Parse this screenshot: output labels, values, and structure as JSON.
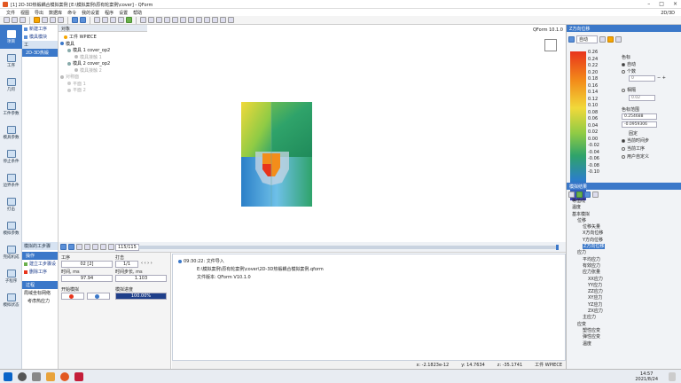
{
  "window": {
    "title": "[1] 2D-3D热锻耦合模拟案例 [E:\\模拟案例\\原有轮案例\\cover] - QForm",
    "view_mode": "2D/3D"
  },
  "menu": {
    "items": [
      "文件",
      "视图",
      "导出",
      "数据库",
      "命令",
      "我的设置",
      "程序",
      "设置",
      "帮助"
    ]
  },
  "left_nav": {
    "items": [
      "项目",
      "工序",
      "几何",
      "工件参数",
      "模具参数",
      "停止条件",
      "边界条件",
      "打击",
      "模拟参数",
      "完成机成",
      "子程序",
      "模拟状态"
    ]
  },
  "process_panel": {
    "new_label": "新建工序",
    "tool_label": "模具模块",
    "section": "工",
    "item": "2D-3D热锻"
  },
  "object_panel": {
    "header": "对象",
    "version": "QForm 10.1.0"
  },
  "tree": [
    {
      "label": "工件 WPIECE",
      "color": "#f7a600"
    },
    {
      "label": "模具",
      "color": "#3b78c9"
    },
    {
      "label": "模具 1 cover_op2",
      "color": "#8aa"
    },
    {
      "label": "模具接触 1",
      "color": "#bbb"
    },
    {
      "label": "模具 2 cover_op2",
      "color": "#8aa"
    },
    {
      "label": "模具接触 2",
      "color": "#bbb"
    },
    {
      "label": "对称面",
      "color": "#bbb"
    },
    {
      "label": "平面 1",
      "color": "#ccc"
    },
    {
      "label": "平面 2",
      "color": "#ccc"
    }
  ],
  "results_panel": {
    "header": "Z方向位移",
    "mode": "自动"
  },
  "color_scale": {
    "ticks": [
      "0.26",
      "0.24",
      "0.22",
      "0.20",
      "0.18",
      "0.16",
      "0.14",
      "0.12",
      "0.10",
      "0.08",
      "0.06",
      "0.04",
      "0.02",
      "0.00",
      "-0.02",
      "-0.04",
      "-0.06",
      "-0.08",
      "-0.10"
    ]
  },
  "scale_options": {
    "color_label": "色标",
    "auto": "自动",
    "count": "个数",
    "count_value": "0",
    "relative": "相隔",
    "relative_value": "0.02",
    "range_label": "色标范围",
    "max": "0.254688",
    "min": "-0.0959306",
    "fixed": "固定",
    "current_step": "当前时间步",
    "current_process": "当前工序",
    "user_defined": "用户自定义"
  },
  "results_tree": {
    "header": "模拟结果",
    "items": [
      "等值线",
      "温度",
      "基本模拟",
      "位移",
      "位移矢量",
      "X方向位移",
      "Y方向位移",
      "Z方向位移",
      "应力",
      "平均应力",
      "有效应力",
      "应力张量",
      "XX应力",
      "YY应力",
      "ZZ应力",
      "XY应力",
      "YZ应力",
      "ZX应力",
      "主应力",
      "应变",
      "塑性应变",
      "弹性应变",
      "温度"
    ],
    "selected": "Z方向位移"
  },
  "sim_panel": {
    "header": "模拟的工步骤",
    "section1": "操作",
    "item1": "建立工步骤设",
    "item2": "删除工序",
    "section2": "过程",
    "item3": "局域坐标网络",
    "item4": "考虑热应力"
  },
  "timebar": {
    "step": "115/115"
  },
  "params": {
    "process_label": "工序",
    "process_value": "02 [2]",
    "blow_label": "打击",
    "blow_value": "1/1",
    "time_label": "时间, ms",
    "time_value": "97.94",
    "blow_time_label": "时间步长, ms",
    "blow_time_value": "1.103",
    "start_label": "开始模拟",
    "progress_label": "模拟进度",
    "progress_value": "100.00%"
  },
  "log": {
    "lines": [
      "09:30:22: 文件导入",
      "E:\\模拟案例\\原有轮案例\\cover\\2D-3D热锻耦合模拟案例.qform",
      "文件版本: QForm V10.1.0"
    ]
  },
  "status": {
    "x": "x: -2.1823e-12",
    "y": "y: 14.7634",
    "z": "z: -35.1741",
    "obj": "工件 WPIECE"
  },
  "taskbar": {
    "time": "14:57",
    "date": "2021/8/24"
  }
}
